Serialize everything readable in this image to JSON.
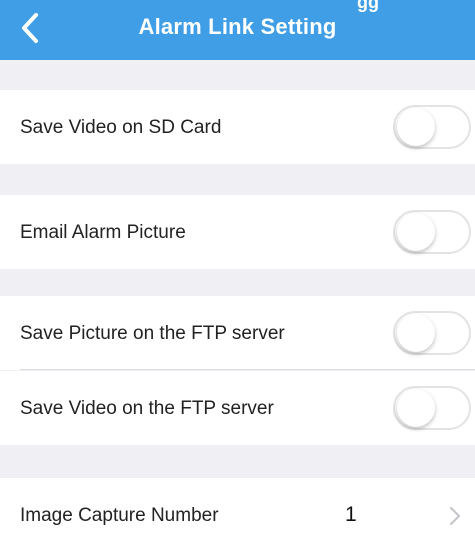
{
  "header": {
    "title": "Alarm Link Setting",
    "clipped_text": "gg",
    "back_icon": "chevron-left-icon",
    "background_color": "#3f9ee6"
  },
  "rows": [
    {
      "label": "Save Video on SD Card",
      "toggle_on": false
    },
    {
      "label": "Email Alarm Picture",
      "toggle_on": false
    },
    {
      "label": "Save Picture on the FTP server",
      "toggle_on": false
    },
    {
      "label": "Save Video on the FTP server",
      "toggle_on": false
    }
  ],
  "capture": {
    "label": "Image Capture Number",
    "value": "1",
    "chevron_icon": "chevron-right-icon"
  }
}
